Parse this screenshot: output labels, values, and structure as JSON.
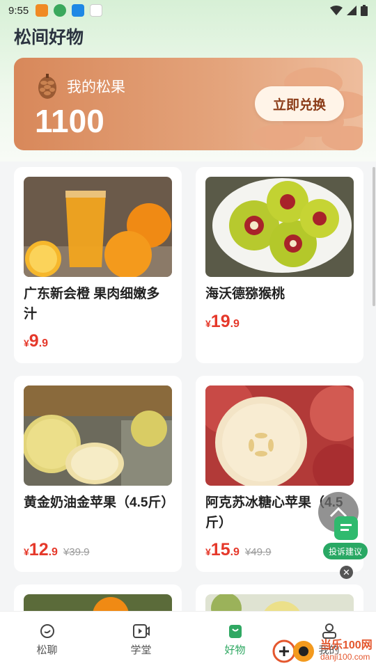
{
  "status_bar": {
    "time": "9:55"
  },
  "header": {
    "title": "松间好物"
  },
  "points_card": {
    "label": "我的松果",
    "value": "1100",
    "redeem_label": "立即兑换"
  },
  "products": [
    {
      "name": "广东新会橙 果肉细嫩多汁",
      "currency": "¥",
      "price_int": "9",
      "price_dec": ".9",
      "old_price": ""
    },
    {
      "name": "海沃德猕猴桃",
      "currency": "¥",
      "price_int": "19",
      "price_dec": ".9",
      "old_price": ""
    },
    {
      "name": "黄金奶油金苹果（4.5斤）",
      "currency": "¥",
      "price_int": "12",
      "price_dec": ".9",
      "old_price": "¥39.9"
    },
    {
      "name": "阿克苏冰糖心苹果（4.5斤）",
      "currency": "¥",
      "price_int": "15",
      "price_dec": ".9",
      "old_price": "¥49.9"
    }
  ],
  "floating": {
    "complaint_label": "投诉建议",
    "close_symbol": "✕"
  },
  "tabs": [
    {
      "label": "松聊",
      "icon": "chat-icon"
    },
    {
      "label": "学堂",
      "icon": "video-icon"
    },
    {
      "label": "好物",
      "icon": "shopping-bag-icon",
      "active": true
    },
    {
      "label": "我的",
      "icon": "user-icon"
    }
  ],
  "watermark": {
    "line1": "当乐100网",
    "line2": "danji100.com"
  },
  "colors": {
    "accent": "#2fa862",
    "price": "#e5382a",
    "card": "#d8885a"
  }
}
